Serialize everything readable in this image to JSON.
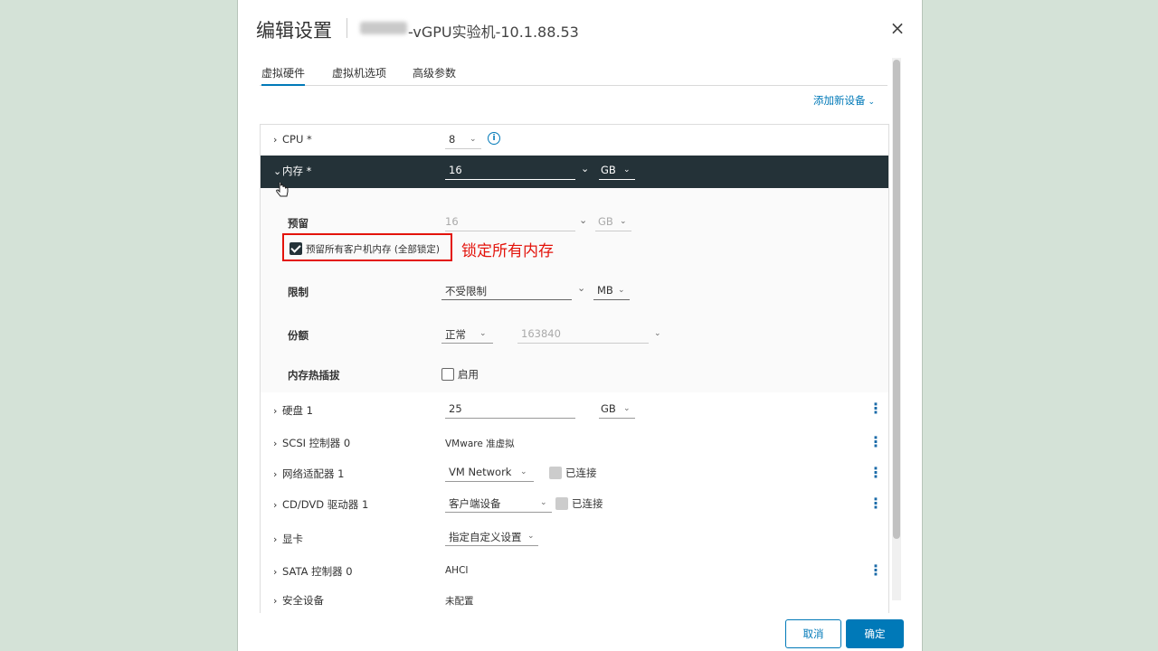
{
  "dialog": {
    "title": "编辑设置",
    "subtitle": "-vGPU实验机-10.1.88.53",
    "close_label": "×"
  },
  "tabs": [
    {
      "label": "虚拟硬件",
      "active": true
    },
    {
      "label": "虚拟机选项",
      "active": false
    },
    {
      "label": "高级参数",
      "active": false
    }
  ],
  "add_device": {
    "label": "添加新设备",
    "chevron": "⌄"
  },
  "rows": {
    "cpu": {
      "label": "CPU *",
      "value": "8"
    },
    "memory": {
      "label": "内存 *",
      "value": "16",
      "unit": "GB"
    },
    "reserve": {
      "label": "预留",
      "value": "16",
      "unit": "GB"
    },
    "reserve_all": {
      "label": "预留所有客户机内存 (全部锁定)",
      "checked": true
    },
    "limit": {
      "label": "限制",
      "value": "不受限制",
      "unit": "MB"
    },
    "shares": {
      "label": "份额",
      "level": "正常",
      "value": "163840"
    },
    "hotplug": {
      "label": "内存热插拔",
      "checkbox_label": "启用",
      "checked": false
    },
    "disk": {
      "label": "硬盘 1",
      "value": "25",
      "unit": "GB"
    },
    "scsi": {
      "label": "SCSI 控制器 0",
      "value": "VMware 准虚拟"
    },
    "network": {
      "label": "网络适配器 1",
      "value": "VM Network",
      "connected_label": "已连接"
    },
    "cddvd": {
      "label": "CD/DVD 驱动器 1",
      "value": "客户端设备",
      "connected_label": "已连接"
    },
    "gpu": {
      "label": "显卡",
      "value": "指定自定义设置"
    },
    "sata": {
      "label": "SATA 控制器 0",
      "value": "AHCI"
    },
    "security": {
      "label": "安全设备",
      "value": "未配置"
    }
  },
  "annotation": {
    "text": "锁定所有内存",
    "color": "#e3130b"
  },
  "footer": {
    "cancel_label": "取消",
    "ok_label": "确定"
  },
  "colors": {
    "accent": "#0079b8",
    "selected_row": "#243238",
    "annotation": "#e3130b"
  },
  "icons": {
    "close": "close-icon",
    "info": "info-icon",
    "kebab": "kebab-menu-icon",
    "chevron_right": "chevron-right-icon",
    "chevron_down": "chevron-down-icon",
    "cursor": "hand-cursor-icon"
  }
}
